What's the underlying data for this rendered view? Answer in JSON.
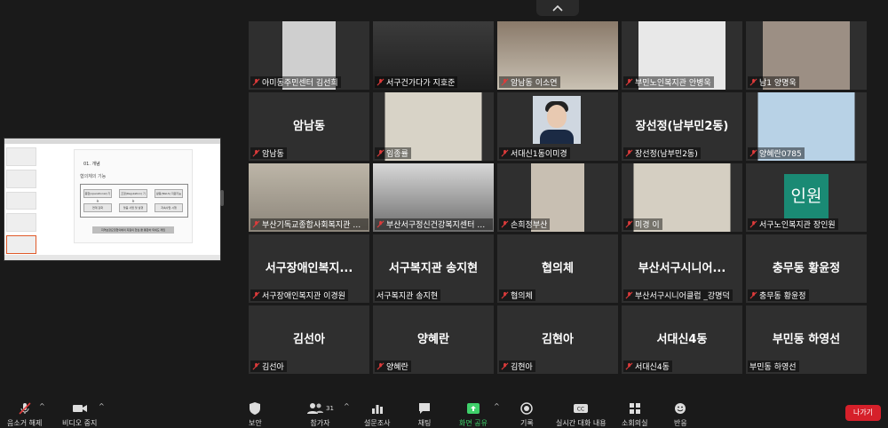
{
  "tiles": [
    {
      "name": "아미동주민센터 김선희",
      "big": ""
    },
    {
      "name": "서구건가다가 지호준",
      "big": ""
    },
    {
      "name": "암남동 이소연",
      "big": ""
    },
    {
      "name": "부민노인복지관 안병욱",
      "big": ""
    },
    {
      "name": "남1 양명욱",
      "big": ""
    },
    {
      "name": "암남동",
      "big": "암남동"
    },
    {
      "name": "임종률",
      "big": ""
    },
    {
      "name": "서대신1동이미경",
      "big": ""
    },
    {
      "name": "장선정(남부민2동)",
      "big": "장선정(남부민2동)"
    },
    {
      "name": "양혜란0785",
      "big": ""
    },
    {
      "name": "부산기독교종합사회복지관 권...",
      "big": ""
    },
    {
      "name": "부산서구정신건강복지센터 임...",
      "big": ""
    },
    {
      "name": "손희정부산",
      "big": ""
    },
    {
      "name": "미경 이",
      "big": ""
    },
    {
      "name": "서구노인복지관 장인원",
      "big": "",
      "avatar_text": "인원"
    },
    {
      "name": "서구장애인복지관 이경원",
      "big": "서구장애인복지..."
    },
    {
      "name": "서구복지관 송지현",
      "big": "서구복지관 송지현"
    },
    {
      "name": "협의체",
      "big": "협의체"
    },
    {
      "name": "부산서구시니어클럽 _강명덕",
      "big": "부산서구시니어..."
    },
    {
      "name": "충무동 황윤정",
      "big": "충무동 황윤정"
    },
    {
      "name": "김선아",
      "big": "김선아"
    },
    {
      "name": "양혜란",
      "big": "양혜란"
    },
    {
      "name": "김현아",
      "big": "김현아"
    },
    {
      "name": "서대신4동",
      "big": "서대신4동"
    },
    {
      "name": "부민동 하영선",
      "big": "부민동 하영선"
    }
  ],
  "shared_slide": {
    "title": "01. 개념",
    "subtitle": "협의체의 기능",
    "buttons": [
      "종합(operational) 기능",
      "조정(Regulation) 기능",
      "활동(NGLS) 지원기능",
      "연계 강화",
      "맞춤 사업 및 실행",
      "지속사업 시행"
    ],
    "bar": "지역보장요청협의체의 지원의 협심 뿐 통합하 되세도 레임"
  },
  "toolbar": {
    "mute": "음소거 해제",
    "video": "비디오 중지",
    "security": "보안",
    "participants": "참가자",
    "participants_count": "31",
    "poll": "설문조사",
    "chat": "채팅",
    "share": "화면 공유",
    "record": "기록",
    "cc": "실시간 대화 내용",
    "breakout": "소회의실",
    "reactions": "반응",
    "leave": "나가기"
  },
  "colors": {
    "accent_green": "#3fd06a",
    "leave_red": "#d6202a",
    "mic_muted": "#e03b3b"
  }
}
